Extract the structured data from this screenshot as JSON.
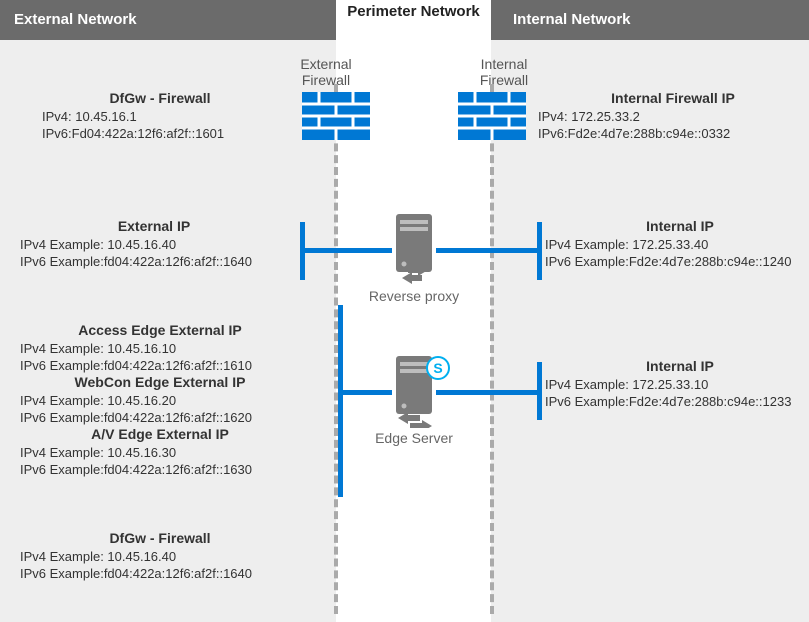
{
  "headers": {
    "external": "External Network",
    "perimeter": "Perimeter Network",
    "internal": "Internal Network"
  },
  "firewall_labels": {
    "external": "External Firewall",
    "internal": "Internal Firewall"
  },
  "nodes": {
    "reverse_proxy": "Reverse proxy",
    "edge_server": "Edge Server"
  },
  "left": {
    "dfgw_top": {
      "title": "DfGw - Firewall",
      "ipv4": "IPv4: 10.45.16.1",
      "ipv6": "IPv6:Fd04:422a:12f6:af2f::1601"
    },
    "external_ip": {
      "title": "External IP",
      "ipv4": "IPv4 Example: 10.45.16.40",
      "ipv6": "IPv6 Example:fd04:422a:12f6:af2f::1640"
    },
    "access_edge": {
      "title": "Access Edge External IP",
      "ipv4": "IPv4 Example: 10.45.16.10",
      "ipv6": "IPv6 Example:fd04:422a:12f6:af2f::1610"
    },
    "webcon_edge": {
      "title": "WebCon Edge External IP",
      "ipv4": "IPv4 Example: 10.45.16.20",
      "ipv6": "IPv6 Example:fd04:422a:12f6:af2f::1620"
    },
    "av_edge": {
      "title": "A/V Edge External IP",
      "ipv4": "IPv4 Example: 10.45.16.30",
      "ipv6": "IPv6 Example:fd04:422a:12f6:af2f::1630"
    },
    "dfgw_bottom": {
      "title": "DfGw - Firewall",
      "ipv4": "IPv4 Example: 10.45.16.40",
      "ipv6": "IPv6 Example:fd04:422a:12f6:af2f::1640"
    }
  },
  "right": {
    "internal_fw": {
      "title": "Internal Firewall IP",
      "ipv4": "IPv4: 172.25.33.2",
      "ipv6": "IPv6:Fd2e:4d7e:288b:c94e::0332"
    },
    "internal_ip_proxy": {
      "title": "Internal IP",
      "ipv4": "IPv4 Example: 172.25.33.40",
      "ipv6": "IPv6 Example:Fd2e:4d7e:288b:c94e::1240"
    },
    "internal_ip_edge": {
      "title": "Internal IP",
      "ipv4": "IPv4 Example: 172.25.33.10",
      "ipv6": "IPv6 Example:Fd2e:4d7e:288b:c94e::1233"
    }
  },
  "colors": {
    "brand": "#0078d4",
    "grey": "#6b6b6b"
  }
}
